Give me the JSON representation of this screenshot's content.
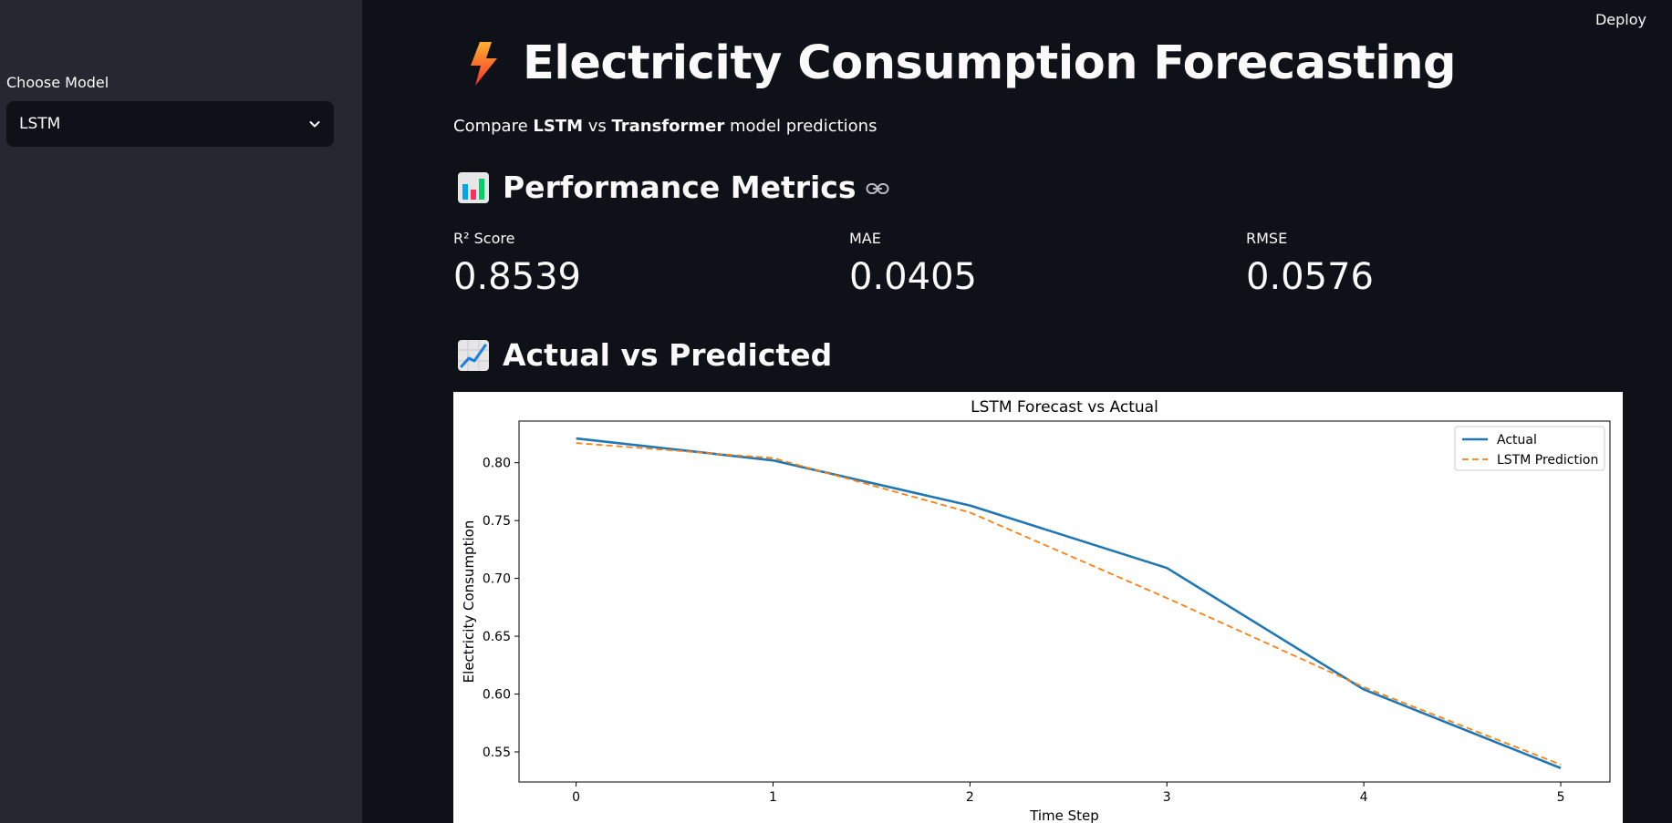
{
  "sidebar": {
    "model_label": "Choose Model",
    "model_selected": "LSTM"
  },
  "header": {
    "deploy_label": "Deploy",
    "title": "Electricity Consumption Forecasting",
    "subtitle": {
      "p1": "Compare ",
      "b1": "LSTM",
      "p2": " vs ",
      "b2": "Transformer",
      "p3": " model predictions"
    }
  },
  "metrics_section": {
    "title": "Performance Metrics",
    "items": [
      {
        "label": "R² Score",
        "value": "0.8539"
      },
      {
        "label": "MAE",
        "value": "0.0405"
      },
      {
        "label": "RMSE",
        "value": "0.0576"
      }
    ]
  },
  "chart_section": {
    "title": "Actual vs Predicted"
  },
  "colors": {
    "actual": "#1f77b4",
    "prediction": "#ff7f0e",
    "app_bg": "#0e1117",
    "sidebar_bg": "#262730"
  },
  "chart_data": {
    "type": "line",
    "title": "LSTM Forecast vs Actual",
    "xlabel": "Time Step",
    "ylabel": "Electricity Consumption",
    "x": [
      0,
      1,
      2,
      3,
      4,
      5
    ],
    "xticks": [
      "0",
      "1",
      "2",
      "3",
      "4",
      "5"
    ],
    "yticks": [
      "0.55",
      "0.60",
      "0.65",
      "0.70",
      "0.75",
      "0.80"
    ],
    "xlim": [
      -0.29,
      5.25
    ],
    "ylim": [
      0.524,
      0.836
    ],
    "grid": false,
    "legend_position": "top-right",
    "series": [
      {
        "name": "Actual",
        "style": "solid",
        "values": [
          0.821,
          0.802,
          0.763,
          0.709,
          0.604,
          0.536
        ]
      },
      {
        "name": "LSTM Prediction",
        "style": "dashed",
        "values": [
          0.817,
          0.804,
          0.757,
          0.683,
          0.606,
          0.539
        ]
      }
    ]
  }
}
